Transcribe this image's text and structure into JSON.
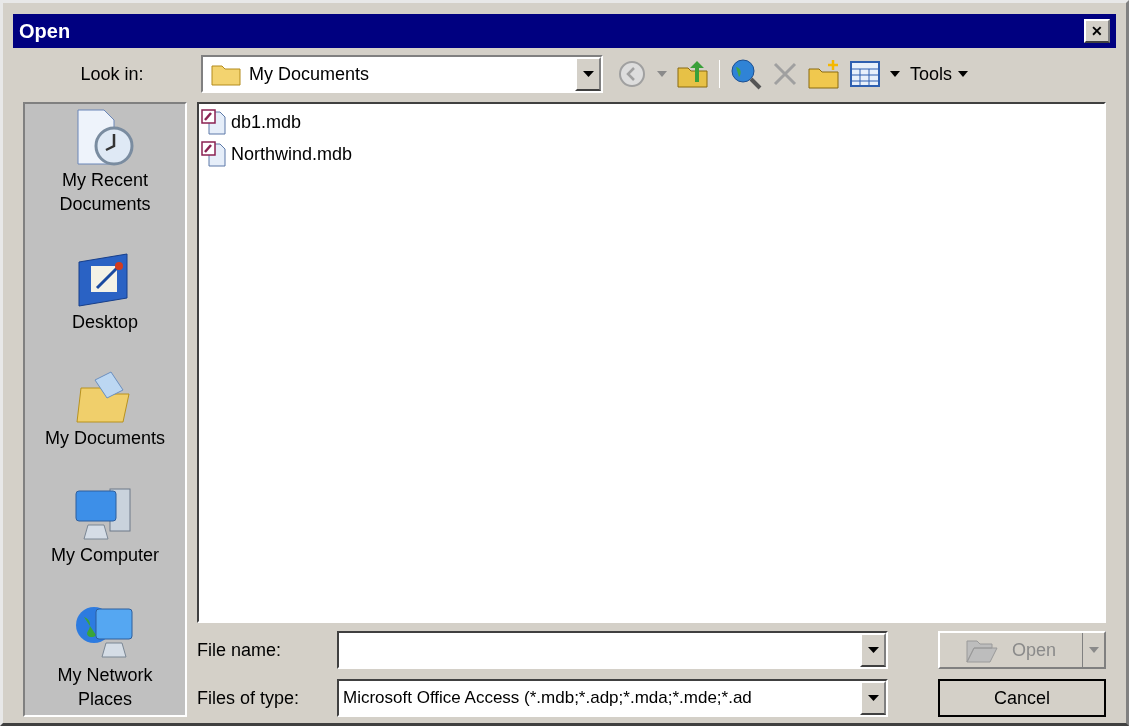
{
  "window": {
    "title": "Open",
    "close": "✕"
  },
  "toolbar": {
    "look_in_label": "Look in:",
    "look_in_value": "My Documents",
    "tools": "Tools"
  },
  "places": [
    {
      "kind": "recent",
      "label": "My Recent Documents"
    },
    {
      "kind": "desktop",
      "label": "Desktop"
    },
    {
      "kind": "documents",
      "label": "My Documents"
    },
    {
      "kind": "computer",
      "label": "My Computer"
    },
    {
      "kind": "network",
      "label": "My Network Places"
    }
  ],
  "files": [
    {
      "name": "db1.mdb"
    },
    {
      "name": "Northwind.mdb"
    }
  ],
  "file_name": {
    "label": "File name:"
  },
  "file_type": {
    "label": "Files of type:",
    "value": "Microsoft Office Access (*.mdb;*.adp;*.mda;*.mde;*.ad"
  },
  "buttons": [
    {
      "label": "Open",
      "disabled": true,
      "split": true
    },
    {
      "label": "Cancel",
      "disabled": false,
      "split": false
    }
  ]
}
